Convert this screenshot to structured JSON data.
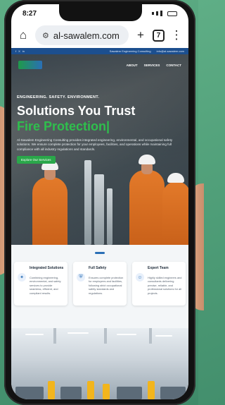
{
  "status": {
    "time": "8:27"
  },
  "browser": {
    "url": "al-sawalem.com",
    "tab_count": "7"
  },
  "site": {
    "topbar": {
      "social": [
        "f",
        "X",
        "in"
      ],
      "contact": "Sawalem Engineering Consulting",
      "email": "info@al-sawalem.com"
    },
    "nav": [
      "ABOUT",
      "SERVICES",
      "CONTACT"
    ],
    "hero": {
      "eyebrow": "ENGINEERING. SAFETY. ENVIRONMENT.",
      "title": "Solutions You Trust",
      "subtitle": "Fire Protection|",
      "description": "Al-Sawalem Engineering Consulting provides integrated engineering, environmental, and occupational safety solutions. We ensure complete protection for your employees, facilities, and operations while maintaining full compliance with all industry regulations and standards.",
      "cta": "Explore Our Services"
    },
    "features": [
      {
        "title": "Integrated Solutions",
        "text": "Combining engineering, environmental, and safety services to provide seamless, efficient, and compliant results.",
        "icon": "puzzle-icon"
      },
      {
        "title": "Full Safety",
        "text": "Ensures complete protection for employees and facilities, following strict occupational safety standards and regulations.",
        "icon": "shield-icon"
      },
      {
        "title": "Expert Team",
        "text": "Highly skilled engineers and consultants delivering precise, reliable, and professional solutions for all projects.",
        "icon": "team-icon"
      }
    ]
  },
  "colors": {
    "accent_green": "#2fbf4d",
    "brand_blue": "#1c4f8f"
  }
}
